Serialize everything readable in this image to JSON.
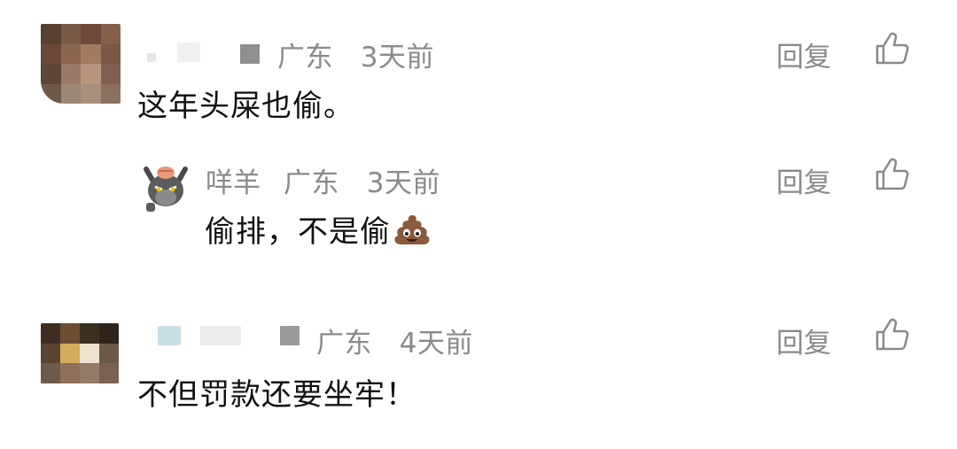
{
  "comments": [
    {
      "location": "广东",
      "time": "3天前",
      "text": "这年头屎也偷。",
      "reply_label": "回复"
    },
    {
      "username": "咩羊",
      "location": "广东",
      "time": "3天前",
      "text": "偷排，不是偷",
      "emoji": "poop-emoji",
      "reply_label": "回复"
    },
    {
      "location": "广东",
      "time": "4天前",
      "text": "不但罚款还要坐牢！",
      "reply_label": "回复"
    }
  ],
  "icons": {
    "like": "thumbs-up-icon",
    "avatar_reply": "wolf-cartoon-avatar"
  },
  "colors": {
    "meta_text": "#8a8a8a",
    "body_text": "#111111",
    "background": "#ffffff"
  }
}
